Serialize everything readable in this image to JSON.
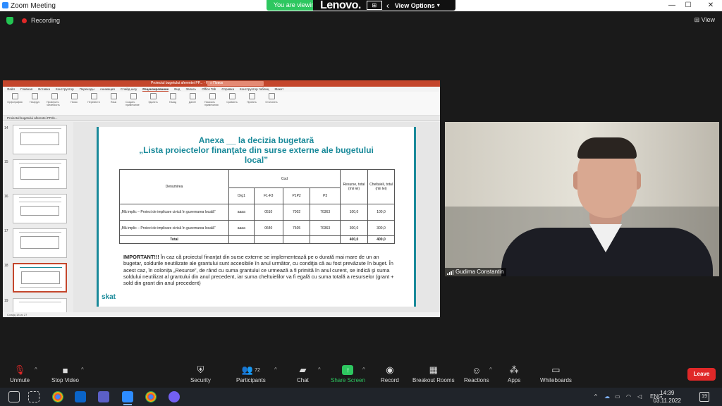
{
  "window": {
    "title": "Zoom Meeting",
    "minimize": "—",
    "maximize": "☐",
    "close": "✕"
  },
  "share_banner": {
    "status": "You are viewing",
    "brand": "Lenovo.",
    "options": "View Options"
  },
  "status": {
    "recording": "Recording",
    "view": "View"
  },
  "presentation": {
    "app_title": "Proiectul bugetului aferentei PP... - PowerPoint",
    "search": "Поиск",
    "tabs": [
      "Файл",
      "Главная",
      "Вставка",
      "Конструктор",
      "Переходы",
      "Анимация",
      "Слайд-шоу",
      "Рецензирование",
      "Вид",
      "Запись",
      "Office Tab",
      "Справка",
      "Конструктор таблиц",
      "Макет"
    ],
    "ribbon": [
      "Орфография",
      "Тезаурус",
      "Проверить читаемость",
      "Поиск",
      "Перевести",
      "Язык",
      "Создать примечание",
      "Удалить",
      "Назад",
      "Далее",
      "Показать примечания",
      "Сравнить",
      "Принять",
      "Отклонить"
    ],
    "file_tab": "Proiectul bugetului aferentei PPds...",
    "thumb_numbers": [
      "14",
      "15",
      "16",
      "17",
      "18",
      "19"
    ],
    "slide_title_line1": "Anexa __ la decizia bugetară",
    "slide_title_line2": "„Lista proiectelor finanţate din surse externe ale bugetului",
    "slide_title_line3": "local”",
    "table": {
      "col_den": "Denumirea",
      "col_cod": "Cod",
      "col_resurse": "Resurse, total (mii lei)",
      "col_cheltuieli": "Cheltuieli, total (mii lei)",
      "sub_cols": [
        "Org1",
        "F1-F3",
        "P1P2",
        "P3"
      ],
      "rows": [
        [
          "„Mă implic – Proiect de implicare civică în guvernarea locală”",
          "aaaa",
          "0510",
          "7002",
          "70363",
          "100,0",
          "100,0"
        ],
        [
          "„Mă implic – Proiect de implicare civică în guvernarea locală”",
          "aaaa",
          "0640",
          "7505",
          "70363",
          "300,0",
          "300,0"
        ]
      ],
      "total_label": "Total",
      "total_resurse": "400,0",
      "total_cheltuieli": "400,0"
    },
    "important_label": "IMPORTANT!!!",
    "important_text": " În caz că proiectul finanţat din surse externe se implementează pe o durată mai mare de un an bugetar, soldurile neutilizate ale grantului sunt accesibile în anul următor, cu condiţia că au fost prevăzute în buget. În acest caz, în coloniţa „Resurse”, de rând cu suma grantului ce urmează a fi primită în anul curent, se indică şi suma soldului neutilizat al grantului din anul precedent, iar suma cheltuielilor va fi egală cu suma totală a resurselor (grant + sold din grant din anul precedent)",
    "logo": "skat",
    "status_bar": "Слайд 18 из 27"
  },
  "participant": {
    "name": "Gudima Constantin"
  },
  "toolbar": {
    "unmute": "Unmute",
    "stop_video": "Stop Video",
    "security": "Security",
    "participants": "Participants",
    "participants_count": "72",
    "chat": "Chat",
    "share_screen": "Share Screen",
    "record": "Record",
    "breakout": "Breakout Rooms",
    "reactions": "Reactions",
    "apps": "Apps",
    "whiteboards": "Whiteboards",
    "leave": "Leave"
  },
  "taskbar": {
    "lang": "ENG",
    "time": "14:39",
    "date": "03.11.2022",
    "notifications": "19"
  }
}
